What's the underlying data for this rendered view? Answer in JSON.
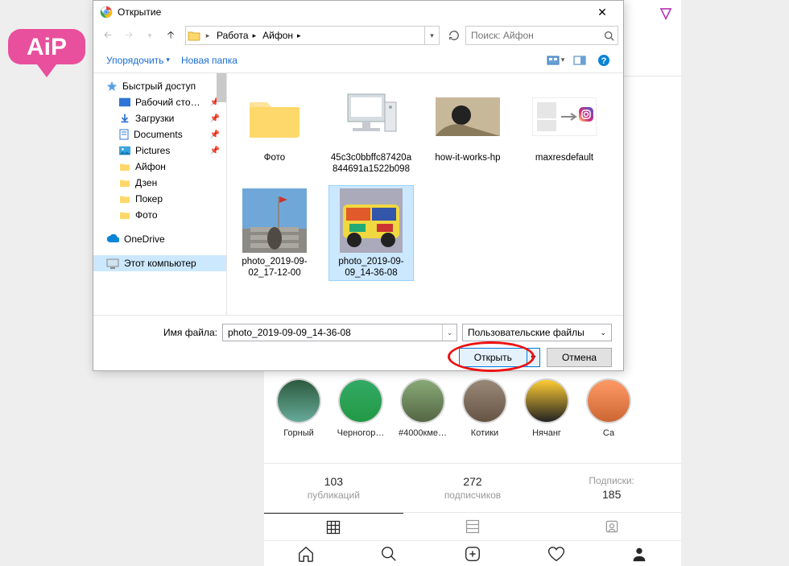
{
  "dialog": {
    "title": "Открытие",
    "breadcrumb": {
      "items": [
        "Работа",
        "Айфон"
      ]
    },
    "search_placeholder": "Поиск: Айфон",
    "organize": "Упорядочить",
    "new_folder": "Новая папка",
    "sidebar": {
      "quick_access": "Быстрый доступ",
      "desktop": "Рабочий сто…",
      "downloads": "Загрузки",
      "documents": "Documents",
      "pictures": "Pictures",
      "iphone": "Айфон",
      "dzen": "Дзен",
      "poker": "Покер",
      "photo": "Фото",
      "onedrive": "OneDrive",
      "this_pc": "Этот компьютер"
    },
    "files": [
      {
        "name": "Фото",
        "type": "folder"
      },
      {
        "name": "45c3c0bbffc87420a844691a1522b098",
        "type": "image-pc"
      },
      {
        "name": "how-it-works-hp",
        "type": "image-hand"
      },
      {
        "name": "maxresdefault",
        "type": "image-ig"
      },
      {
        "name": "photo_2019-09-02_17-12-00",
        "type": "photo-1"
      },
      {
        "name": "photo_2019-09-09_14-36-08",
        "type": "photo-2",
        "selected": true
      }
    ],
    "file_name_label": "Имя файла:",
    "file_name_value": "photo_2019-09-09_14-36-08",
    "file_type": "Пользовательские файлы",
    "open_btn": "Открыть",
    "cancel_btn": "Отмена"
  },
  "instagram": {
    "stories": [
      {
        "label": "Горный"
      },
      {
        "label": "Черногор…"
      },
      {
        "label": "#4000кме…"
      },
      {
        "label": "Котики"
      },
      {
        "label": "Нячанг"
      },
      {
        "label": "Са"
      }
    ],
    "stats": {
      "posts_n": "103",
      "posts_t": "публикаций",
      "followers_n": "272",
      "followers_t": "подписчиков",
      "following_t": "Подписки:",
      "following_n": "185"
    }
  }
}
